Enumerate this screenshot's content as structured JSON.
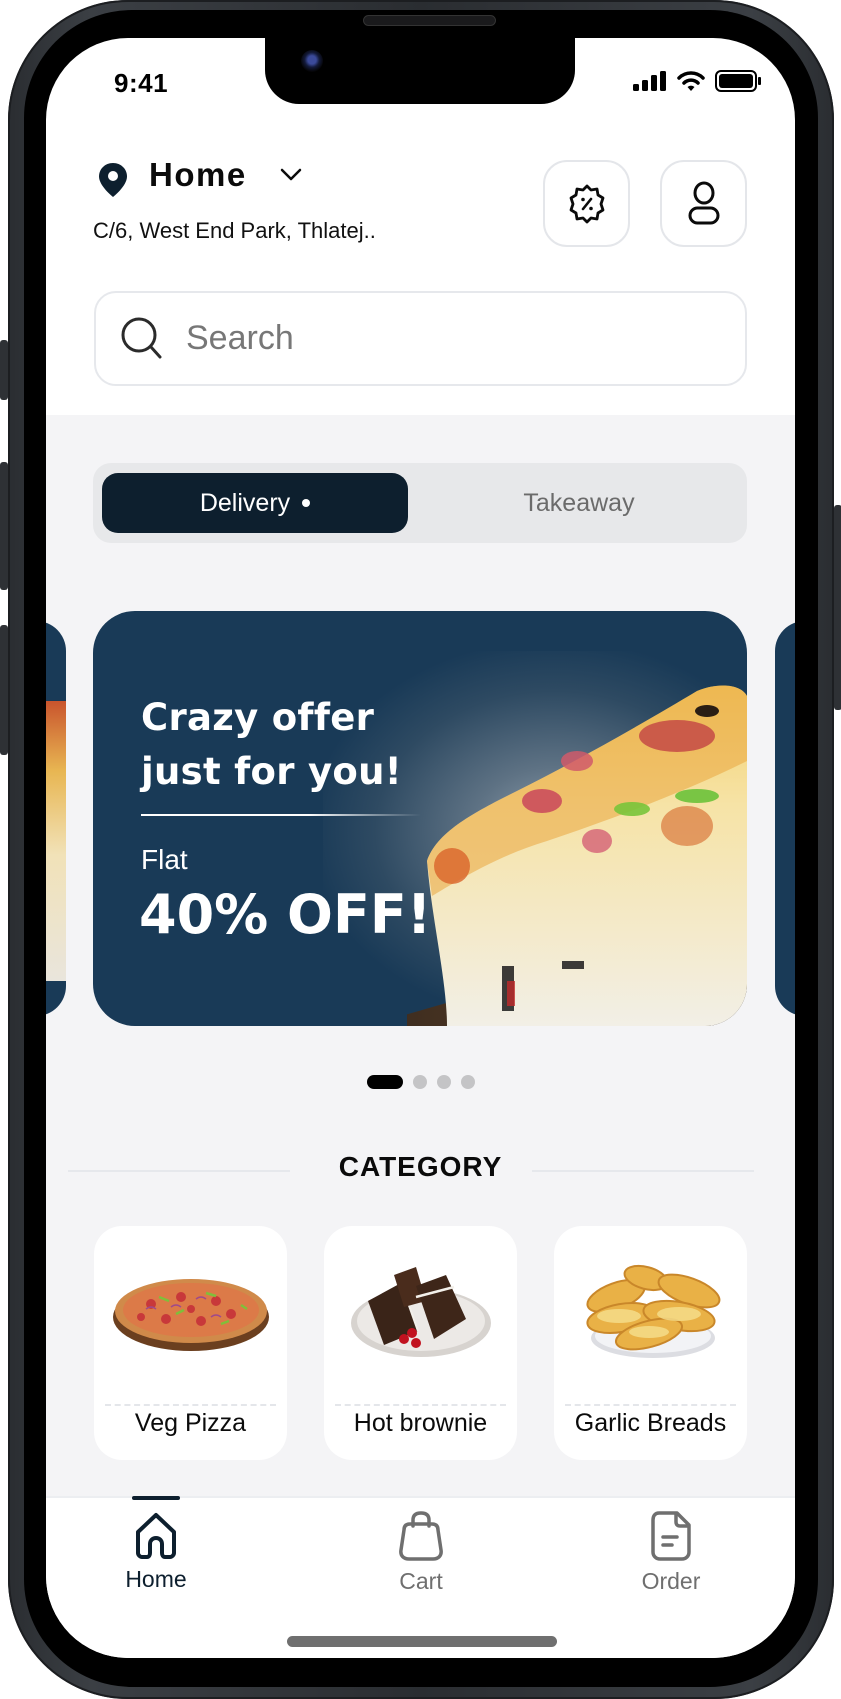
{
  "status_bar": {
    "time": "9:41",
    "icons": [
      "cellular-signal-icon",
      "wifi-icon",
      "battery-icon"
    ]
  },
  "header": {
    "location_label": "Home",
    "address": "C/6, West End Park, Thlatej..",
    "icons": {
      "location": "map-pin-icon",
      "dropdown": "chevron-down-icon",
      "offers": "discount-badge-icon",
      "profile": "user-icon"
    }
  },
  "search": {
    "placeholder": "Search",
    "value": ""
  },
  "order_mode": {
    "tabs": [
      {
        "label": "Delivery",
        "active": true
      },
      {
        "label": "Takeaway",
        "active": false
      }
    ]
  },
  "banner": {
    "title_line1": "Crazy offer",
    "title_line2": "just for you!",
    "subtitle": "Flat",
    "discount": "40% OFF!",
    "carousel": {
      "total": 4,
      "active_index": 0
    }
  },
  "category": {
    "title": "CATEGORY",
    "items": [
      {
        "label": "Veg Pizza",
        "image": "veg-pizza-image"
      },
      {
        "label": "Hot brownie",
        "image": "hot-brownie-image"
      },
      {
        "label": "Garlic Breads",
        "image": "garlic-bread-image"
      }
    ]
  },
  "bottom_nav": {
    "items": [
      {
        "label": "Home",
        "icon": "home-icon",
        "active": true
      },
      {
        "label": "Cart",
        "icon": "shopping-bag-icon",
        "active": false
      },
      {
        "label": "Order",
        "icon": "document-icon",
        "active": false
      }
    ]
  },
  "colors": {
    "primary_dark": "#0d1f2e",
    "banner_blue": "#193a57",
    "background_grey": "#f4f4f6",
    "segment_bg": "#e7e8ea",
    "inactive_text": "#6b6b6b"
  }
}
